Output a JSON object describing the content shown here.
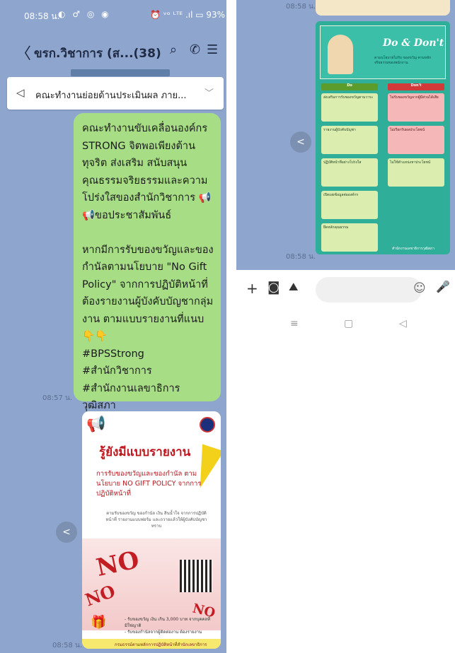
{
  "left": {
    "status": {
      "time": "08:58 น.",
      "icons": "◐ ♂ ◎ ◉",
      "right": "⏰ ᵛᵒ ᴸᵀᴱ .ıl ▭ 93%"
    },
    "header": {
      "back": "〈",
      "title": "ขรก.วิชาการ (ส...(38)",
      "search_icon": "⌕",
      "call_icon": "✆",
      "menu_icon": "☰"
    },
    "pinned": {
      "icon": "◁",
      "text": "คณะทำงานย่อยด้านประเมินผล ภาย...",
      "chevron": "﹀"
    },
    "message": {
      "text": "คณะทำงานขับเคลื่อนองค์กร STRONG จิตพอเพียงต้านทุจริต ส่งเสริม สนับสนุนคุณธรรมจริยธรรมและความโปร่งใสของสำนักวิชาการ 📢📢ขอประชาสัมพันธ์\n\nหากมีการรับของขวัญและของกำนัลตามนโยบาย \"No Gift Policy\" จากการปฏิบัติหน้าที่ ต้องรายงานผู้บังคับบัญชากลุ่มงาน ตามแบบรายงานที่แนบ 👇👇\n#BPSStrong\n#สำนักวิชาการ\n#สำนักงานเลขาธิการวุฒิสภา",
      "time": "08:57 น."
    },
    "poster": {
      "megaphone": "📢",
      "heading": "รู้ยังมีแบบรายงาน",
      "subheading": "การรับของขวัญและของกำนัล ตามนโยบาย NO GIFT POLICY จากการปฏิบัติหน้าที่",
      "note": "ตามรับของขวัญ ของกำนัล เงิน สินน้ำใจ จากการปฏิบัติหน้าที่ รายงานแบบฟอร์ม และถวายแล้วให้ผู้บังคับบัญชาทราบ",
      "no1": "NO",
      "no2": "NO",
      "no3": "NO",
      "gift": "🎁",
      "footer": "- รับของขวัญ เงิน เกิน 3,000 บาท จากบุคคลที่มิใช่ญาติ\n- รับของกำนัลจากผู้ติดต่องาน ต้องรายงาน",
      "band": "กรมธรรม์ตามหลักการปฏิบัติหน้าที่สำนักเลขาธิการวุฒิสภา",
      "time": "08:58 น."
    },
    "share_icon": "<"
  },
  "right": {
    "top_time": "08:58 น.",
    "dodont": {
      "title": "Do & Don't",
      "subtitle": "ตามนโยบายไม่รับ ของขวัญ ตามหลักจริยธรรมของพนักงาน",
      "do_label": "Do",
      "dont_label": "Don't",
      "do_items": [
        "ส่งเสริมการรับของขวัญตามวาระ",
        "รายงานผู้บังคับบัญชา",
        "ปฏิบัติหน้าที่อย่างโปร่งใส",
        "เปิดเผยข้อมูลต่อองค์กร",
        "ยึดหลักคุณธรรม"
      ],
      "dont_items": [
        "ไม่รับของขวัญจากผู้มีส่วนได้เสีย",
        "ไม่เรียกรับผลประโยชน์",
        "ไม่ใช้ตำแหน่งหาประโยชน์"
      ],
      "footer": "สำนักงานเลขาธิการวุฒิสภา"
    },
    "time": "08:58 น.",
    "input": {
      "plus": "+",
      "camera": "◙",
      "image": "⛰",
      "smile": "☺",
      "mic": "🎤"
    },
    "nav": {
      "recent": "≡",
      "home": "▢",
      "back": "◁"
    },
    "share_icon": "<"
  }
}
